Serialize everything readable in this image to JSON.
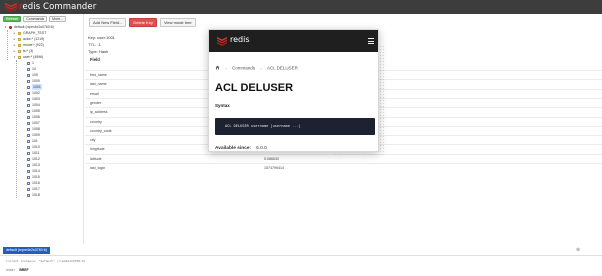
{
  "app": {
    "title_pre": "",
    "title_r": "r",
    "title_post": "edis Commander",
    "brand_color": "#d82c20"
  },
  "sidebar": {
    "toolbar": {
      "refresh": "Refresh",
      "commands": "Commands",
      "more": "More..."
    },
    "connection": "default (rcpm4e2s0760:6)",
    "groups": [
      {
        "label": "GRAPH_TEST"
      },
      {
        "label": "actor:* (1219)"
      },
      {
        "label": "movie:* (922)"
      },
      {
        "label": "ts:* (3)"
      },
      {
        "label": "user:* (4996)"
      }
    ],
    "keys": [
      "1",
      "10",
      "100",
      "1000",
      "1001",
      "1002",
      "1003",
      "1004",
      "1005",
      "1006",
      "1007",
      "1008",
      "1009",
      "101",
      "1010",
      "1011",
      "1012",
      "1013",
      "1014",
      "1015",
      "1016",
      "1017",
      "1018"
    ],
    "selected_key": "1001"
  },
  "key_panel": {
    "key": "Key: user:1001",
    "ttl": "TTL: -1",
    "type": "Type: Hash",
    "buttons": {
      "add_field": "Add New Field...",
      "delete_key": "Delete Key",
      "view_tree": "View mode tree"
    },
    "field_header": "Field",
    "fields": [
      {
        "name": "first_name",
        "value": ""
      },
      {
        "name": "last_name",
        "value": ""
      },
      {
        "name": "email",
        "value": ""
      },
      {
        "name": "gender",
        "value": ""
      },
      {
        "name": "ip_address",
        "value": ""
      },
      {
        "name": "country",
        "value": ""
      },
      {
        "name": "country_code",
        "value": ""
      },
      {
        "name": "city",
        "value": "Savaneta"
      },
      {
        "name": "longitude",
        "value": "-73.264199"
      },
      {
        "name": "latitude",
        "value": "5.086630"
      },
      {
        "name": "last_login",
        "value": "1574799414"
      }
    ]
  },
  "popup": {
    "brand": "redis",
    "breadcrumb": [
      "Commands",
      "ACL DELUSER"
    ],
    "title": "ACL DELUSER",
    "syntax_label": "Syntax",
    "syntax": "ACL DELUSER username [username ...]",
    "available_label": "Available since:",
    "available_version": "6.0.0"
  },
  "console": {
    "tab": "default (rcpm4e2s0760:6)",
    "line": "Current instance: \"default\" (rcpm4e2s0760:6)",
    "prompt_label": "redis>",
    "prompt_cmd": "BREF"
  }
}
